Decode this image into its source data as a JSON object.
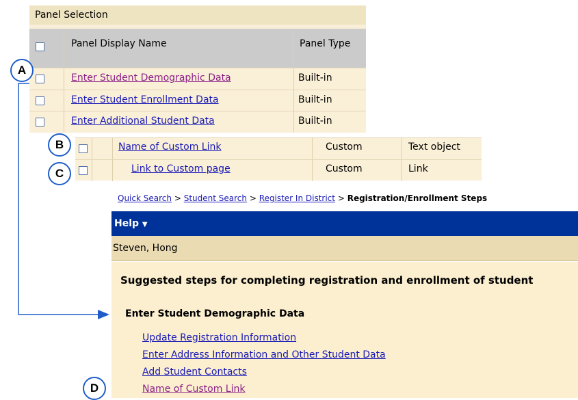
{
  "panel": {
    "title": "Panel Selection",
    "columns": [
      "Panel Display Name",
      "Panel Type"
    ],
    "rows": [
      {
        "name": "Enter Student Demographic Data",
        "type": "Built-in"
      },
      {
        "name": "Enter Student Enrollment Data",
        "type": "Built-in"
      },
      {
        "name": "Enter Additional Student Data",
        "type": "Built-in"
      }
    ]
  },
  "custom_rows": [
    {
      "name": "Name of Custom Link",
      "type": "Custom",
      "object": "Text object"
    },
    {
      "name": "Link to Custom page",
      "type": "Custom",
      "object": "Link"
    }
  ],
  "callouts": {
    "a": "A",
    "b": "B",
    "c": "C",
    "d": "D"
  },
  "breadcrumb": {
    "items": [
      "Quick Search",
      "Student Search",
      "Register In District"
    ],
    "separator": ">",
    "current": "Registration/Enrollment Steps"
  },
  "navbar": {
    "help_label": "Help"
  },
  "student_name": "Steven, Hong",
  "main": {
    "heading": "Suggested steps for completing registration and enrollment of student",
    "section_title": "Enter Student Demographic Data",
    "steps": [
      "Update Registration Information",
      "Enter Address Information and Other Student Data",
      "Add Student Contacts",
      "Name of Custom Link"
    ]
  },
  "colors": {
    "navbar": "#003399",
    "link": "#1a1ab5",
    "visited_link": "#8b1f87",
    "callout_border": "#1f5ec9"
  }
}
